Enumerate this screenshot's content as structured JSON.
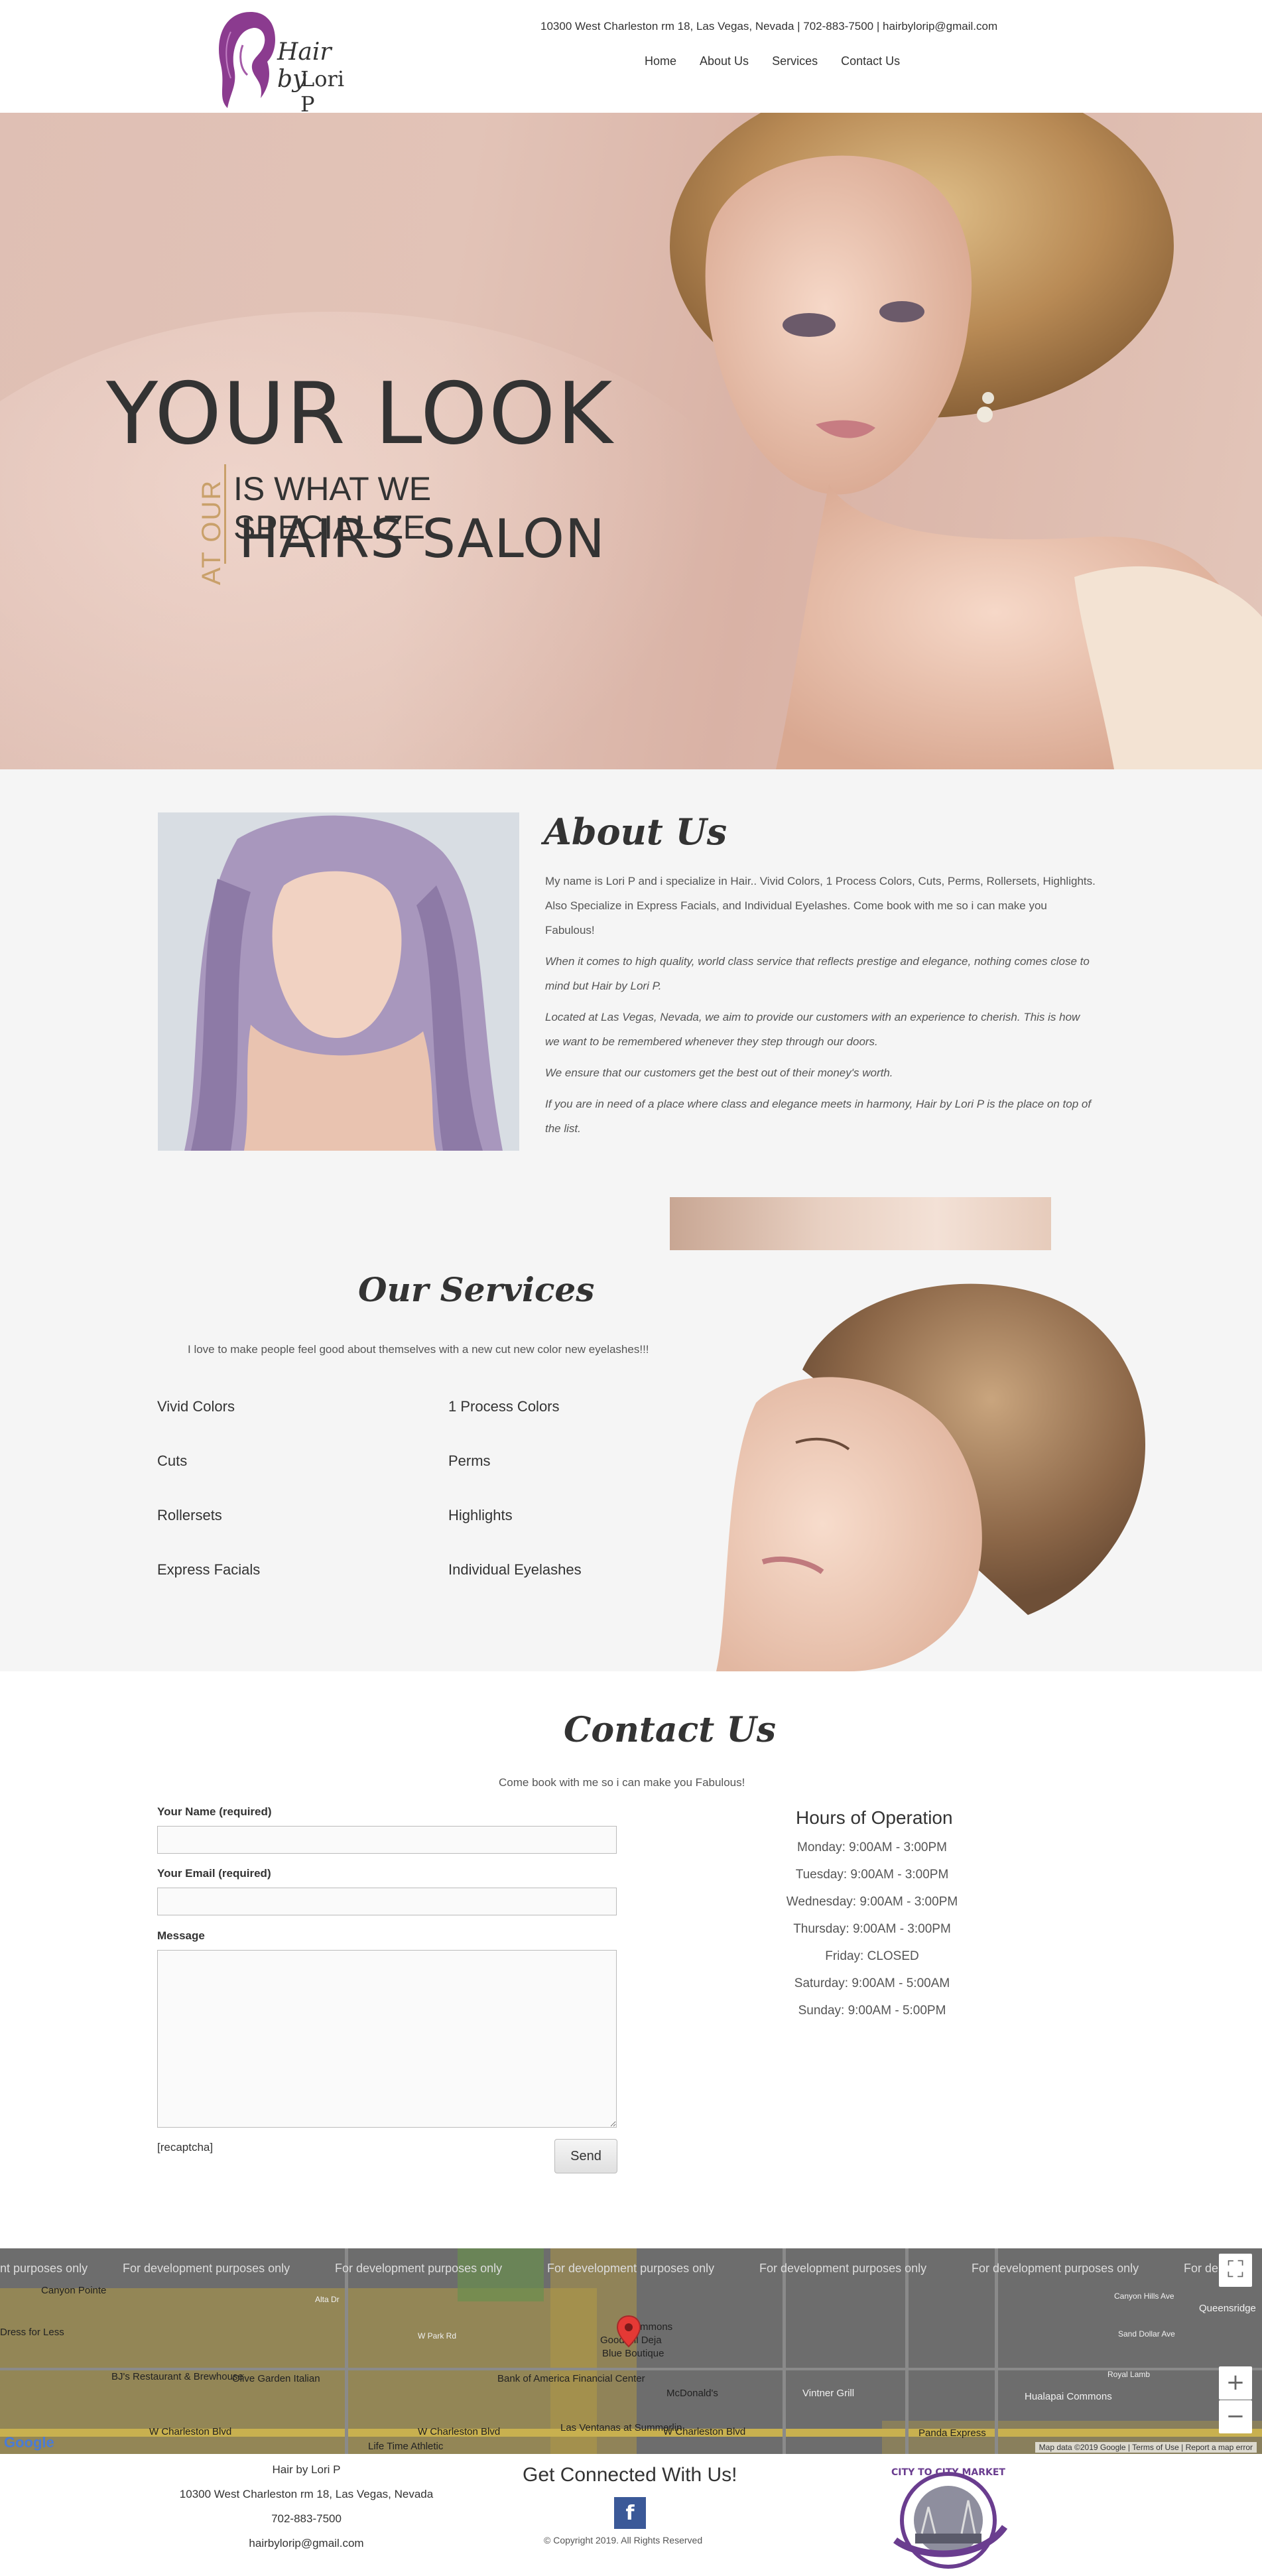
{
  "header": {
    "logo_line1": "Hair by",
    "logo_line2": "Lori P",
    "contact_bar": "10300 West Charleston rm 18, Las Vegas, Nevada | 702-883-7500 | hairbylorip@gmail.com",
    "nav": [
      {
        "label": "Home"
      },
      {
        "label": "About Us"
      },
      {
        "label": "Services"
      },
      {
        "label": "Contact Us"
      }
    ]
  },
  "hero": {
    "title": "YOUR LOOK",
    "at_our": "AT OUR",
    "line1": "IS WHAT WE SPECIALIZE",
    "line2": "HAIRS SALON"
  },
  "about": {
    "title": "About Us",
    "paragraphs": [
      "My name is Lori P and i specialize in Hair.. Vivid Colors, 1 Process Colors, Cuts, Perms, Rollersets, Highlights. Also Specialize in Express Facials, and Individual Eyelashes. Come book with me so i can make you Fabulous!",
      "When it comes to high quality, world class service that reflects prestige and elegance, nothing comes close to mind but Hair by Lori P.",
      "Located at Las Vegas, Nevada, we aim to provide our customers with an experience to cherish. This is how we want to be remembered whenever they step through our doors.",
      "We ensure that our customers get the best out of their money's worth.",
      "If you are in need of a place where class and elegance meets in harmony, Hair by Lori P is the place on top of the list."
    ]
  },
  "services": {
    "title": "Our Services",
    "intro": "I love to make people feel good about themselves with a new cut new color new eyelashes!!!",
    "items": [
      "Vivid Colors",
      "1 Process Colors",
      "Cuts",
      "Perms",
      "Rollersets",
      "Highlights",
      "Express Facials",
      "Individual Eyelashes"
    ]
  },
  "contact": {
    "title": "Contact Us",
    "subtitle": "Come book with me so i can make you Fabulous!",
    "name_label": "Your Name (required)",
    "email_label": "Your Email (required)",
    "message_label": "Message",
    "name_value": "",
    "email_value": "",
    "message_value": "",
    "recaptcha": "[recaptcha]",
    "send_label": "Send"
  },
  "hours": {
    "title": "Hours of Operation",
    "lines": [
      "Monday: 9:00AM - 3:00PM",
      "Tuesday: 9:00AM - 3:00PM",
      "Wednesday: 9:00AM - 3:00PM",
      "Thursday: 9:00AM - 3:00PM",
      "Friday: CLOSED",
      "Saturday: 9:00AM - 5:00AM",
      "Sunday: 9:00AM - 5:00PM"
    ]
  },
  "map": {
    "watermark": "For development purposes only",
    "watermark_left_fragment": "nt purposes only",
    "watermark_right_fragment": "For de",
    "labels": {
      "canyon_pointe": "Canyon Pointe",
      "dress_for_less": "Dress for Less",
      "bjs": "BJ's Restaurant & Brewhouse",
      "olive_garden": "Olive Garden Italian",
      "bank_of_america": "Bank of America Financial Center",
      "mcdonalds": "McDonald's",
      "blue_boutique": "Blue Boutique",
      "goodwill": "Goodwill Deja",
      "commons": "mmons",
      "vintner_grill": "Vintner Grill",
      "canyon_hills_ave": "Canyon Hills Ave",
      "queensridge": "Queensridge",
      "sand_dollar": "Sand Dollar Ave",
      "royal_lamb": "Royal Lamb",
      "huala": "Hualapai Commons",
      "w_charleston_1": "W Charleston Blvd",
      "w_charleston_2": "W Charleston Blvd",
      "w_charleston_3": "W Charleston Blvd",
      "las_ventanas": "Las Ventanas at Summerlin",
      "panda": "Panda Express",
      "life_time": "Life Time Athletic",
      "park_rd": "W Park Rd",
      "alta_dr": "Alta Dr"
    },
    "google": "Google",
    "footer": "Map data ©2019 Google  |  Terms of Use  |  Report a map error",
    "zoom_in": "+",
    "zoom_out": "−",
    "fullscreen": "⛶"
  },
  "footer": {
    "business_name": "Hair by Lori P",
    "address": "10300 West Charleston rm 18, Las Vegas, Nevada",
    "phone": "702-883-7500",
    "email": "hairbylorip@gmail.com",
    "connect_heading": "Get Connected With Us!",
    "facebook_glyph": "f",
    "copyright": "© Copyright 2019. All Rights Reserved",
    "badge_text": "CITY TO CITY MARKET"
  }
}
